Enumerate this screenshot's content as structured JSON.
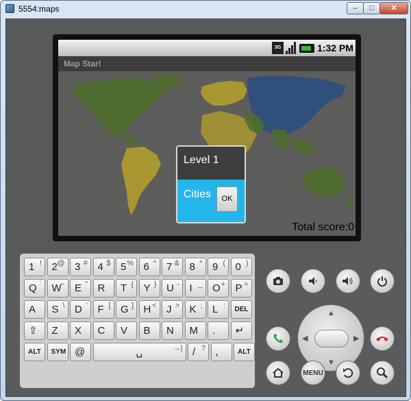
{
  "window": {
    "title": "5554:maps",
    "controls": {
      "minimize": "–",
      "maximize": "□",
      "close": "✕"
    }
  },
  "device": {
    "statusbar": {
      "network": "3G",
      "time": "1:32 PM"
    },
    "app": {
      "title": "Map Star!",
      "total_score": "Total score:0",
      "dialog": {
        "title": "Level 1",
        "message": "Cities",
        "ok_label": "OK"
      }
    }
  },
  "keyboard": {
    "rows": [
      [
        {
          "main": "1",
          "alt": "!"
        },
        {
          "main": "2",
          "alt": "@"
        },
        {
          "main": "3",
          "alt": "#"
        },
        {
          "main": "4",
          "alt": "$"
        },
        {
          "main": "5",
          "alt": "%"
        },
        {
          "main": "6",
          "alt": "^"
        },
        {
          "main": "7",
          "alt": "&"
        },
        {
          "main": "8",
          "alt": "*"
        },
        {
          "main": "9",
          "alt": "("
        },
        {
          "main": "0",
          "alt": ")"
        }
      ],
      [
        {
          "main": "Q",
          "alt": "`"
        },
        {
          "main": "W",
          "alt": "~"
        },
        {
          "main": "E",
          "alt": "\""
        },
        {
          "main": "R",
          "alt": ""
        },
        {
          "main": "T",
          "alt": "{"
        },
        {
          "main": "Y",
          "alt": "}"
        },
        {
          "main": "U",
          "alt": "-"
        },
        {
          "main": "I",
          "alt": "_"
        },
        {
          "main": "O",
          "alt": "+"
        },
        {
          "main": "P",
          "alt": "="
        }
      ],
      [
        {
          "main": "A",
          "alt": ""
        },
        {
          "main": "S",
          "alt": "\\"
        },
        {
          "main": "D",
          "alt": "'"
        },
        {
          "main": "F",
          "alt": "["
        },
        {
          "main": "G",
          "alt": "]"
        },
        {
          "main": "H",
          "alt": "<"
        },
        {
          "main": "J",
          "alt": ">"
        },
        {
          "main": "K",
          "alt": ";"
        },
        {
          "main": "L",
          "alt": ":"
        },
        {
          "main": "DEL",
          "alt": ""
        }
      ],
      [
        {
          "main": "⇧",
          "alt": ""
        },
        {
          "main": "Z",
          "alt": ""
        },
        {
          "main": "X",
          "alt": ""
        },
        {
          "main": "C",
          "alt": ""
        },
        {
          "main": "V",
          "alt": ""
        },
        {
          "main": "B",
          "alt": ""
        },
        {
          "main": "N",
          "alt": ""
        },
        {
          "main": "M",
          "alt": ""
        },
        {
          "main": ".",
          "alt": ""
        },
        {
          "main": "↵",
          "alt": ""
        }
      ],
      [
        {
          "main": "ALT",
          "alt": ""
        },
        {
          "main": "SYM",
          "alt": ""
        },
        {
          "main": "@",
          "alt": ""
        },
        {
          "main": "␣",
          "alt": "→|"
        },
        {
          "main": "/",
          "alt": "?"
        },
        {
          "main": ",",
          "alt": ""
        },
        {
          "main": "ALT",
          "alt": ""
        }
      ]
    ]
  },
  "hardware_buttons": {
    "camera_icon": "camera-icon",
    "volume_down_icon": "volume-down-icon",
    "volume_up_icon": "volume-up-icon",
    "power_icon": "power-icon",
    "call_icon": "call-icon",
    "end_call_icon": "end-call-icon",
    "home_icon": "home-icon",
    "menu_label": "MENU",
    "back_icon": "back-icon",
    "search_icon": "search-icon"
  },
  "colors": {
    "map_green": "#4e6f2a",
    "map_yellow": "#b6a12b",
    "map_blue": "#2c4e7e",
    "map_red": "#9b2b22",
    "dialog_body": "#23b6ea",
    "call_green": "#2aa04b",
    "end_call_red": "#d02a2a"
  }
}
